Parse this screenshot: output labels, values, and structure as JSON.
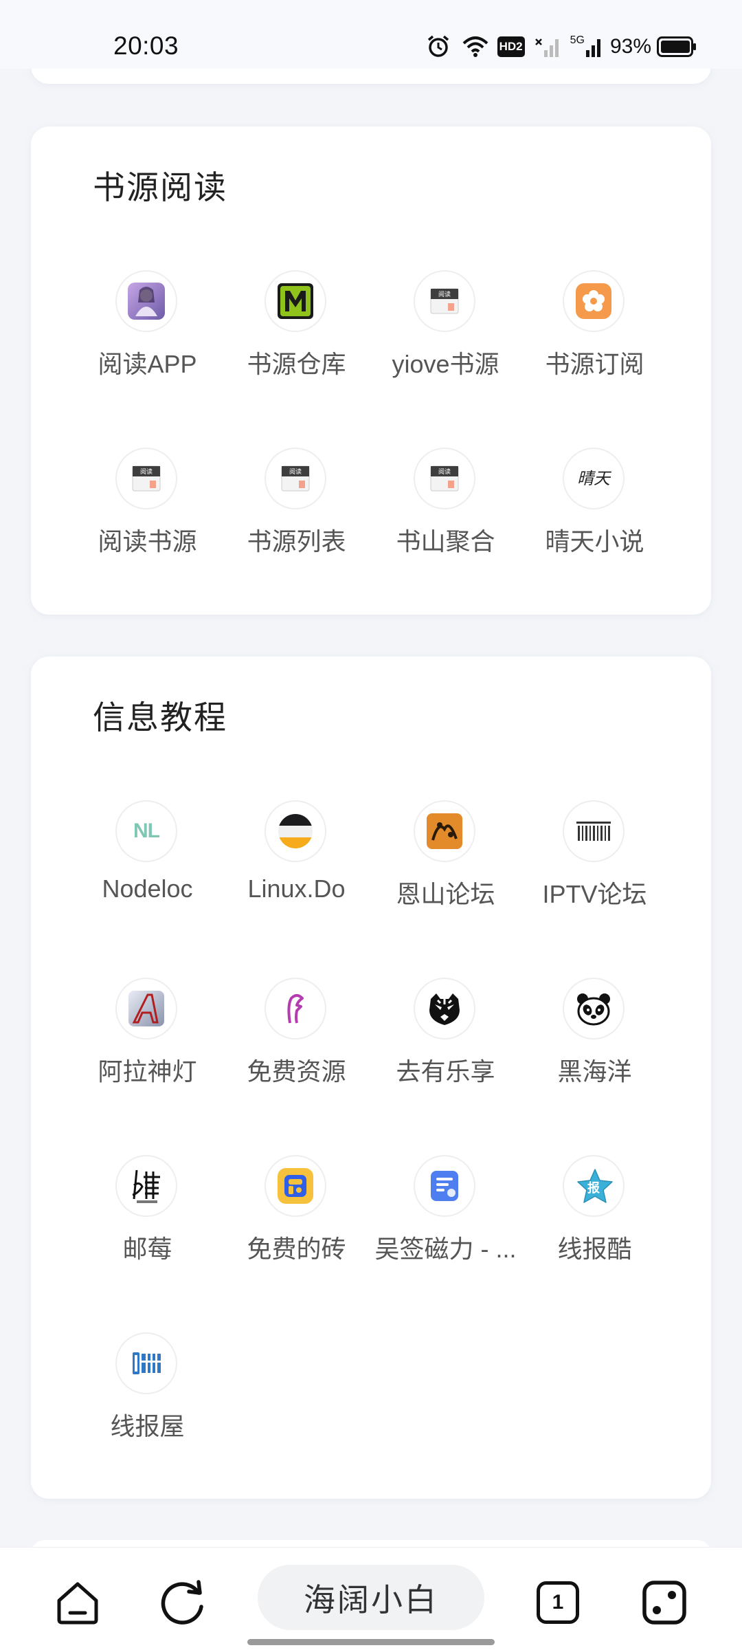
{
  "status_bar": {
    "time": "20:03",
    "battery_percent": "93%",
    "network": "5G",
    "hd_badge": "HD2",
    "icons": [
      "alarm-icon",
      "wifi-icon",
      "hd-icon",
      "signal-no-sim-icon",
      "signal-5g-icon",
      "battery-icon"
    ]
  },
  "sections": [
    {
      "title": "书源阅读",
      "items": [
        {
          "label": "阅读APP",
          "icon": "reading-app-icon"
        },
        {
          "label": "书源仓库",
          "icon": "m-logo-icon"
        },
        {
          "label": "yiove书源",
          "icon": "book-icon"
        },
        {
          "label": "书源订阅",
          "icon": "flower-icon"
        },
        {
          "label": "阅读书源",
          "icon": "book-icon"
        },
        {
          "label": "书源列表",
          "icon": "book-icon"
        },
        {
          "label": "书山聚合",
          "icon": "book-icon"
        },
        {
          "label": "晴天小说",
          "icon": "qingtian-icon"
        }
      ]
    },
    {
      "title": "信息教程",
      "items": [
        {
          "label": "Nodeloc",
          "icon": "nl-logo-icon",
          "icon_text": "NL"
        },
        {
          "label": "Linux.Do",
          "icon": "linuxdo-icon"
        },
        {
          "label": "恩山论坛",
          "icon": "enshan-icon"
        },
        {
          "label": "IPTV论坛",
          "icon": "iptv-icon"
        },
        {
          "label": "阿拉神灯",
          "icon": "a-logo-icon"
        },
        {
          "label": "免费资源",
          "icon": "f-logo-icon"
        },
        {
          "label": "去有乐享",
          "icon": "tiger-icon"
        },
        {
          "label": "黑海洋",
          "icon": "panda-icon"
        },
        {
          "label": "邮莓",
          "icon": "youmei-icon"
        },
        {
          "label": "免费的砖",
          "icon": "brick-icon"
        },
        {
          "label": "吴签磁力 - ...",
          "icon": "doc-icon"
        },
        {
          "label": "线报酷",
          "icon": "star-icon",
          "icon_text": "报"
        },
        {
          "label": "线报屋",
          "icon": "xianbaowu-icon"
        }
      ]
    }
  ],
  "bottom_nav": {
    "title": "海阔小白",
    "tab_count": "1",
    "icons": [
      "home-icon",
      "refresh-icon",
      "tabs-icon",
      "dice-icon"
    ]
  },
  "colors": {
    "background": "#f3f5f9",
    "card": "#ffffff",
    "text": "#555555",
    "title": "#222222"
  }
}
